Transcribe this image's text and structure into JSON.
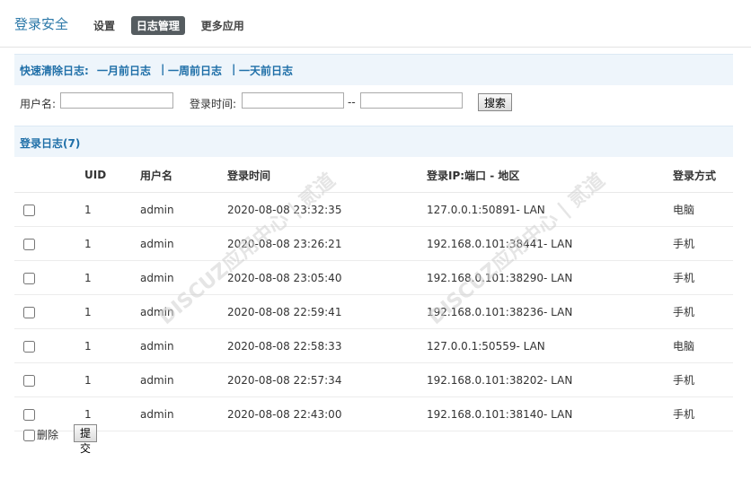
{
  "header": {
    "title": "登录安全",
    "nav": [
      "设置",
      "日志管理",
      "更多应用"
    ],
    "active_index": 1
  },
  "quick_clear": {
    "label": "快速清除日志:",
    "links": [
      "一月前日志",
      "一周前日志",
      "一天前日志"
    ],
    "separator": "|"
  },
  "search": {
    "username_label": "用户名:",
    "username_value": "",
    "time_label": "登录时间:",
    "time_from": "",
    "time_sep": "--",
    "time_to": "",
    "button": "搜索"
  },
  "log": {
    "title": "登录日志(7)",
    "columns": [
      "UID",
      "用户名",
      "登录时间",
      "登录IP:端口 - 地区",
      "登录方式"
    ],
    "rows": [
      {
        "uid": "1",
        "user": "admin",
        "time": "2020-08-08 23:32:35",
        "ip": "127.0.0.1:50891- LAN",
        "method": "电脑"
      },
      {
        "uid": "1",
        "user": "admin",
        "time": "2020-08-08 23:26:21",
        "ip": "192.168.0.101:38441- LAN",
        "method": "手机"
      },
      {
        "uid": "1",
        "user": "admin",
        "time": "2020-08-08 23:05:40",
        "ip": "192.168.0.101:38290- LAN",
        "method": "手机"
      },
      {
        "uid": "1",
        "user": "admin",
        "time": "2020-08-08 22:59:41",
        "ip": "192.168.0.101:38236- LAN",
        "method": "手机"
      },
      {
        "uid": "1",
        "user": "admin",
        "time": "2020-08-08 22:58:33",
        "ip": "127.0.0.1:50559- LAN",
        "method": "电脑"
      },
      {
        "uid": "1",
        "user": "admin",
        "time": "2020-08-08 22:57:34",
        "ip": "192.168.0.101:38202- LAN",
        "method": "手机"
      },
      {
        "uid": "1",
        "user": "admin",
        "time": "2020-08-08 22:43:00",
        "ip": "192.168.0.101:38140- LAN",
        "method": "手机"
      }
    ]
  },
  "footer": {
    "delete_label": "删除",
    "submit": "提交"
  },
  "watermark": "DISCUZ应用中心 | 贰道"
}
